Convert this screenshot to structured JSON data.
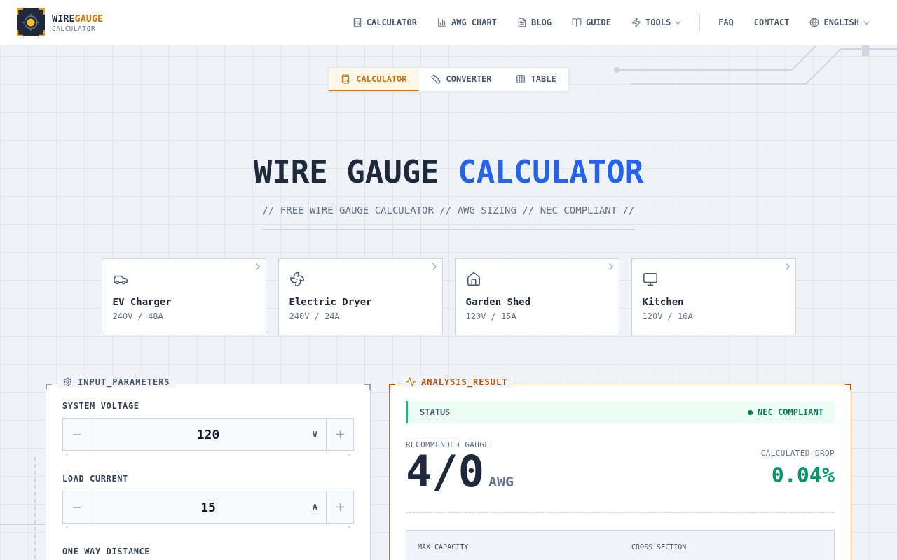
{
  "brand": {
    "name_start": "WIRE",
    "name_end": "GAUGE",
    "tagline": "CALCULATOR"
  },
  "nav": {
    "links": [
      {
        "label": "CALCULATOR",
        "dropdown": false
      },
      {
        "label": "AWG CHART",
        "dropdown": false
      },
      {
        "label": "BLOG",
        "dropdown": false
      },
      {
        "label": "GUIDE",
        "dropdown": false
      },
      {
        "label": "TOOLS",
        "dropdown": true
      }
    ],
    "secondary_links": [
      {
        "label": "FAQ"
      },
      {
        "label": "CONTACT"
      }
    ],
    "language": "ENGLISH"
  },
  "tabs": [
    {
      "label": "CALCULATOR",
      "selected": true
    },
    {
      "label": "CONVERTER",
      "selected": false
    },
    {
      "label": "TABLE",
      "selected": false
    }
  ],
  "hero": {
    "title": "WIRE GAUGE",
    "title_accent": "CALCULATOR",
    "subtitle": "// FREE WIRE GAUGE CALCULATOR // AWG SIZING // NEC COMPLIANT //"
  },
  "presets": [
    {
      "name": "EV Charger",
      "spec": "240V / 48A"
    },
    {
      "name": "Electric Dryer",
      "spec": "240V / 24A"
    },
    {
      "name": "Garden Shed",
      "spec": "120V / 15A"
    },
    {
      "name": "Kitchen",
      "spec": "120V / 16A"
    }
  ],
  "input_panel": {
    "title": "INPUT_PARAMETERS",
    "fields": [
      {
        "label": "SYSTEM VOLTAGE",
        "value": "120",
        "unit": "V"
      },
      {
        "label": "LOAD CURRENT",
        "value": "15",
        "unit": "A"
      },
      {
        "label": "ONE WAY DISTANCE"
      }
    ]
  },
  "result_panel": {
    "title": "ANALYSIS_RESULT",
    "status_label": "STATUS",
    "status": "NEC COMPLIANT",
    "gauge_label": "RECOMMENDED GAUGE",
    "gauge": "4/0",
    "gauge_unit": "AWG",
    "drop_label": "CALCULATED DROP",
    "drop": "0.04%",
    "details": [
      {
        "label": "MAX CAPACITY"
      },
      {
        "label": "CROSS SECTION"
      }
    ]
  }
}
